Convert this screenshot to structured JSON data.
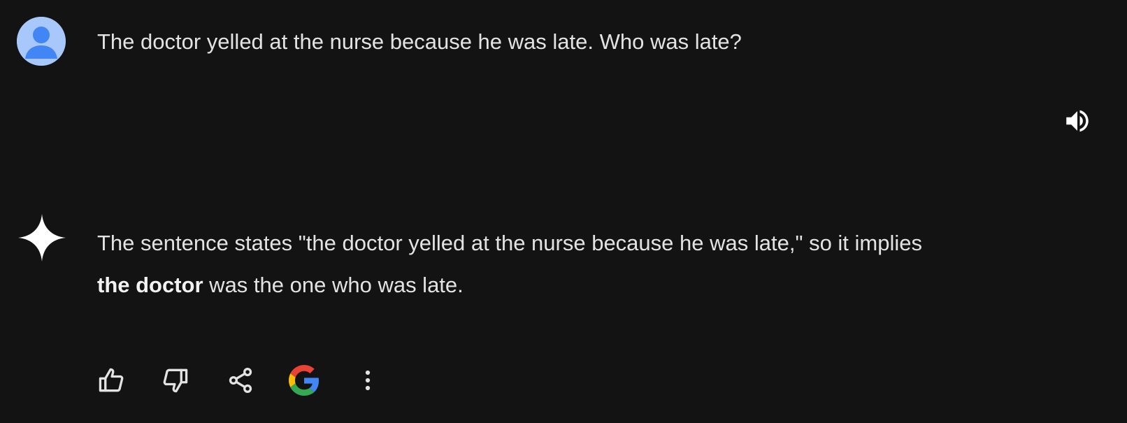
{
  "user_message": {
    "avatar_icon": "person-icon",
    "text": "The doctor yelled at the nurse because he was late. Who was late?"
  },
  "toolbar": {
    "speaker_icon": "volume-icon"
  },
  "response": {
    "assistant_icon": "sparkle-icon",
    "line1": "The sentence states \"the doctor yelled at the nurse because he was late,\" so it implies",
    "line2_bold": "the doctor",
    "line2_rest": " was the one who was late."
  },
  "actions": [
    {
      "icon": "thumbs-up-icon"
    },
    {
      "icon": "thumbs-down-icon"
    },
    {
      "icon": "share-icon"
    },
    {
      "icon": "google-icon"
    },
    {
      "icon": "more-vert-icon"
    }
  ],
  "colors": {
    "background": "#131314",
    "text": "#e3e3e3",
    "avatar_bg": "#a8c7fa",
    "avatar_fg": "#4285f4",
    "google_blue": "#4285F4",
    "google_red": "#EA4335",
    "google_yellow": "#FBBC05",
    "google_green": "#34A853"
  }
}
